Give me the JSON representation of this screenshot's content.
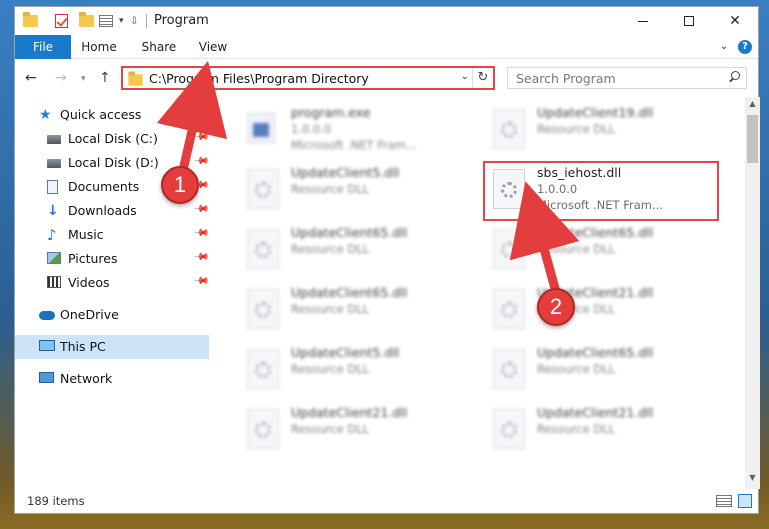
{
  "window": {
    "title": "Program"
  },
  "ribbon": {
    "file": "File",
    "home": "Home",
    "share": "Share",
    "view": "View"
  },
  "address": {
    "path": "C:\\Program Files\\Program Directory"
  },
  "search": {
    "placeholder": "Search Program"
  },
  "sidebar": {
    "items": [
      {
        "label": "Quick access",
        "icon": "star-icon"
      },
      {
        "label": "Local Disk (C:)",
        "icon": "disk-icon",
        "pinned": true
      },
      {
        "label": "Local Disk (D:)",
        "icon": "disk-icon",
        "pinned": true
      },
      {
        "label": "Documents",
        "icon": "documents-icon",
        "pinned": true
      },
      {
        "label": "Downloads",
        "icon": "downloads-icon",
        "pinned": true
      },
      {
        "label": "Music",
        "icon": "music-icon",
        "pinned": true
      },
      {
        "label": "Pictures",
        "icon": "pictures-icon",
        "pinned": true
      },
      {
        "label": "Videos",
        "icon": "videos-icon",
        "pinned": true
      },
      {
        "label": "OneDrive",
        "icon": "onedrive-icon"
      },
      {
        "label": "This PC",
        "icon": "this-pc-icon",
        "selected": true
      },
      {
        "label": "Network",
        "icon": "network-icon"
      }
    ]
  },
  "files": [
    {
      "name": "program.exe",
      "line1": "1.0.0.0",
      "line2": "Microsoft .NET Fram..."
    },
    {
      "name": "UpdateClient19.dll",
      "line1": "Resource DLL",
      "line2": ""
    },
    {
      "name": "UpdateClient5.dll",
      "line1": "Resource DLL",
      "line2": ""
    },
    {
      "name": "sbs_iehost.dll",
      "line1": "1.0.0.0",
      "line2": "Microsoft .NET Fram..."
    },
    {
      "name": "UpdateClient65.dll",
      "line1": "Resource DLL",
      "line2": ""
    },
    {
      "name": "UpdateClient65.dll",
      "line1": "Resource DLL",
      "line2": ""
    },
    {
      "name": "UpdateClient65.dll",
      "line1": "Resource DLL",
      "line2": ""
    },
    {
      "name": "UpdateClient21.dll",
      "line1": "Resource DLL",
      "line2": ""
    },
    {
      "name": "UpdateClient5.dll",
      "line1": "Resource DLL",
      "line2": ""
    },
    {
      "name": "UpdateClient65.dll",
      "line1": "Resource DLL",
      "line2": ""
    },
    {
      "name": "UpdateClient21.dll",
      "line1": "Resource DLL",
      "line2": ""
    },
    {
      "name": "UpdateClient21.dll",
      "line1": "Resource DLL",
      "line2": ""
    }
  ],
  "status": {
    "items": "189 items"
  },
  "callouts": {
    "one": "1",
    "two": "2"
  },
  "colors": {
    "accent": "#1979ca",
    "highlight": "#e04848",
    "callout": "#e43d3d",
    "selected": "#cce4f7"
  }
}
